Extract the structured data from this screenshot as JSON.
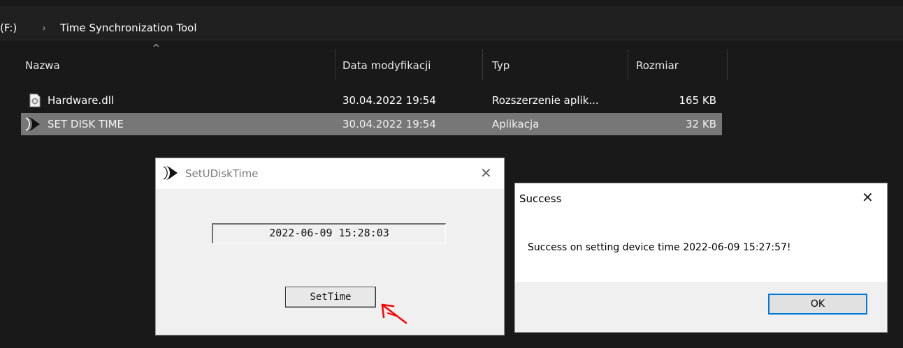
{
  "address_bar": {
    "drive": "(F:)",
    "separator": "›",
    "folder": "Time Synchronization Tool"
  },
  "columns": [
    {
      "label": "Nazwa"
    },
    {
      "label": "Data modyfikacji"
    },
    {
      "label": "Typ"
    },
    {
      "label": "Rozmiar"
    }
  ],
  "files": [
    {
      "name": "Hardware.dll",
      "date": "30.04.2022 19:54",
      "type": "Rozszerzenie aplik...",
      "size": "165 KB",
      "icon": "dll-file-icon",
      "selected": false
    },
    {
      "name": "SET DISK TIME",
      "date": "30.04.2022 19:54",
      "type": "Aplikacja",
      "size": "32 KB",
      "icon": "app-icon",
      "selected": true
    }
  ],
  "setdisk_window": {
    "title": "SetUDiskTime",
    "close": "✕",
    "time_value": "2022-06-09 15:28:03",
    "button_label": "SetTime"
  },
  "success_dialog": {
    "title": "Success",
    "close": "✕",
    "message": "Success on setting device time 2022-06-09 15:27:57!",
    "ok_label": "OK"
  },
  "colors": {
    "explorer_bg": "#191919",
    "selected_row": "#777777",
    "dialog_accent": "#0078d7",
    "annotation_red": "#ff0000"
  }
}
